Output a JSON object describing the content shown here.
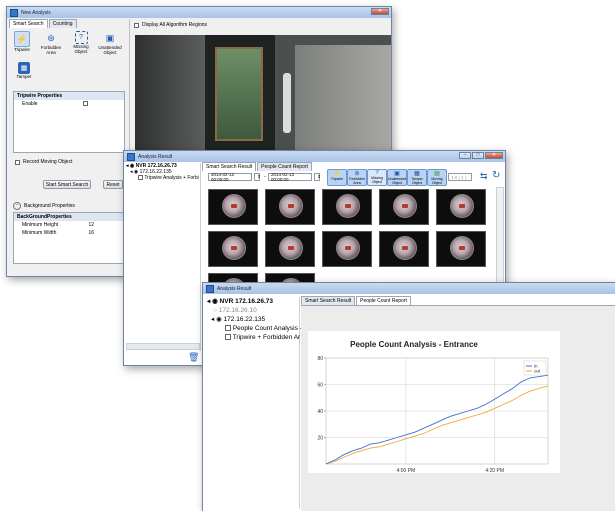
{
  "win1": {
    "title": "New Analysis",
    "tabs": [
      "Smart Search",
      "Counting"
    ],
    "tools": [
      {
        "label": "Tripwire"
      },
      {
        "label": "Forbidden Area"
      },
      {
        "label": "Missing Object"
      },
      {
        "label": "Unattended Object"
      },
      {
        "label": "Tamper"
      }
    ],
    "display_all_label": "Display All Algorithm Regions",
    "tripwire_props_title": "Tripwire Properties",
    "enable_label": "Enable",
    "record_moving_label": "Record Moving Object",
    "start_button": "Start Smart Search",
    "reset_button": "Reset",
    "background_props_label": "Background Properties",
    "bg_section_title": "BackGroundProperties",
    "min_height_label": "Minimum Height",
    "min_height_value": "12",
    "min_width_label": "Minimum Width",
    "min_width_value": "16"
  },
  "win2": {
    "title": "Analysis Result",
    "tree": {
      "root": "NVR 172.16.26.73",
      "child": "172.16.22.135",
      "leaf": "Tripwire Analysis + Forbi"
    },
    "tabs": [
      "Smart Search Result",
      "People Count Report"
    ],
    "start_time": "2014-02-12 00:00:00",
    "range_sep": "-",
    "end_time": "2014-02-13 00:00:00",
    "filters": [
      "Tripwire",
      "Forbidden Area",
      "Missing Object",
      "Unattended Object",
      "Tamper Object",
      "Moving Object"
    ],
    "speed_value": "1.0 ( 1 )"
  },
  "win3": {
    "title": "Analysis Result",
    "tree": {
      "root": "NVR 172.16.26.73",
      "child1": "172.16.26.10",
      "child2": "172.16.22.135",
      "leaf1": "People Count Analysis -",
      "leaf2": "Tripwire + Forbidden Ar"
    },
    "tabs": [
      "Smart Search Result",
      "People Count Report"
    ]
  },
  "chart_data": {
    "type": "line",
    "title": "People Count Analysis - Entrance",
    "xlabel": "",
    "ylabel": "",
    "ylim": [
      0,
      80
    ],
    "yticks": [
      "80",
      "60",
      "40",
      "20"
    ],
    "xticks": [
      {
        "label": "4:00 PM",
        "at": 18
      },
      {
        "label": "4:20 PM",
        "at": 38
      }
    ],
    "x": [
      0,
      2,
      4,
      6,
      8,
      10,
      12,
      14,
      16,
      18,
      20,
      22,
      24,
      26,
      28,
      30,
      32,
      34,
      36,
      38,
      40,
      42,
      44,
      46,
      48,
      50
    ],
    "series": [
      {
        "name": "in",
        "color": "#3f6fd1",
        "values": [
          0,
          3,
          7,
          10,
          12,
          15,
          16,
          18,
          20,
          22,
          24,
          27,
          30,
          33,
          36,
          38,
          40,
          42,
          45,
          49,
          53,
          57,
          62,
          65,
          66,
          67
        ]
      },
      {
        "name": "out",
        "color": "#f0a63c",
        "values": [
          0,
          2,
          5,
          8,
          10,
          12,
          13,
          15,
          17,
          19,
          21,
          23,
          26,
          29,
          31,
          33,
          35,
          37,
          39,
          42,
          45,
          48,
          52,
          55,
          57,
          59
        ]
      }
    ],
    "legend": "top-right",
    "grid": true
  }
}
